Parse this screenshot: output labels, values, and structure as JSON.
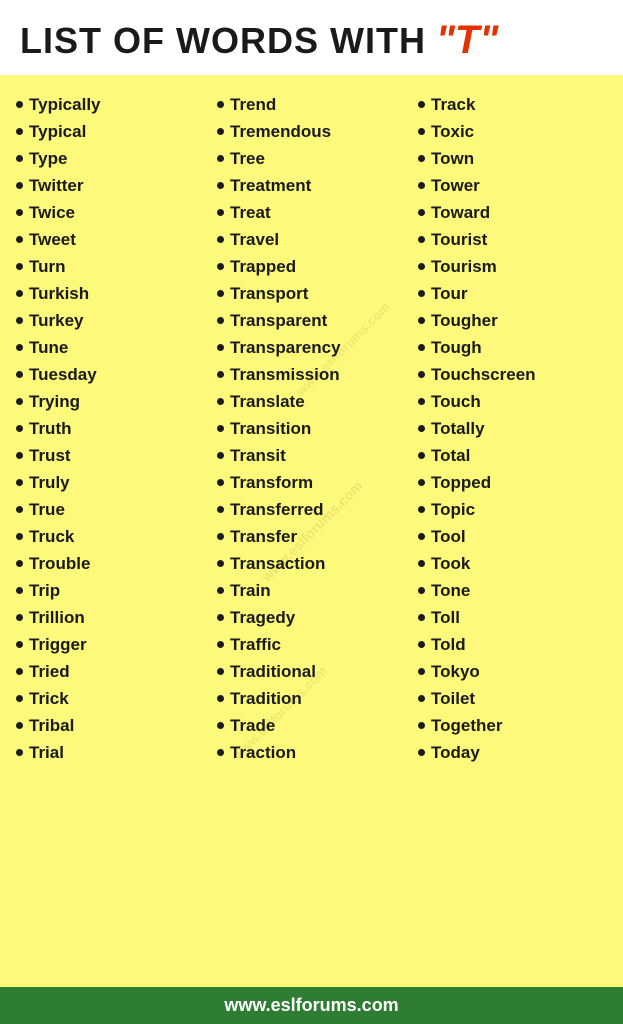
{
  "header": {
    "title": "LIST OF WORDS WITH",
    "letter": "\"T\""
  },
  "columns": [
    {
      "words": [
        "Typically",
        "Typical",
        "Type",
        "Twitter",
        "Twice",
        "Tweet",
        "Turn",
        "Turkish",
        "Turkey",
        "Tune",
        "Tuesday",
        "Trying",
        "Truth",
        "Trust",
        "Truly",
        "True",
        "Truck",
        "Trouble",
        "Trip",
        "Trillion",
        "Trigger",
        "Tried",
        "Trick",
        "Tribal",
        "Trial"
      ]
    },
    {
      "words": [
        "Trend",
        "Tremendous",
        "Tree",
        "Treatment",
        "Treat",
        "Travel",
        "Trapped",
        "Transport",
        "Transparent",
        "Transparency",
        "Transmission",
        "Translate",
        "Transition",
        "Transit",
        "Transform",
        "Transferred",
        "Transfer",
        "Transaction",
        "Train",
        "Tragedy",
        "Traffic",
        "Traditional",
        "Tradition",
        "Trade",
        "Traction"
      ]
    },
    {
      "words": [
        "Track",
        "Toxic",
        "Town",
        "Tower",
        "Toward",
        "Tourist",
        "Tourism",
        "Tour",
        "Tougher",
        "Tough",
        "Touchscreen",
        "Touch",
        "Totally",
        "Total",
        "Topped",
        "Topic",
        "Tool",
        "Took",
        "Tone",
        "Toll",
        "Told",
        "Tokyo",
        "Toilet",
        "Together",
        "Today"
      ]
    }
  ],
  "watermarks": [
    "www.eslforums.com",
    "www.eslforums.com",
    "www.eslforums.com"
  ],
  "footer": {
    "url": "www.eslforums.com"
  }
}
